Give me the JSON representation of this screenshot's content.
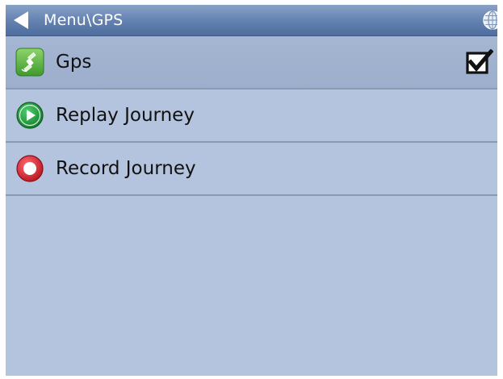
{
  "titlebar": {
    "title": "Menu\\GPS",
    "back_icon": "back-arrow-icon",
    "globe_icon": "globe-icon"
  },
  "menu": {
    "items": [
      {
        "label": "Gps",
        "icon": "satellite-icon",
        "checked": true
      },
      {
        "label": "Replay Journey",
        "icon": "play-icon"
      },
      {
        "label": "Record Journey",
        "icon": "record-icon"
      }
    ]
  },
  "colors": {
    "titlebar": "#6886b4",
    "background": "#b4c4de",
    "selected_row": "#a0b2ce",
    "play_green": "#1f9a3a",
    "record_red": "#d8283a",
    "satellite_green": "#4cae3a"
  }
}
